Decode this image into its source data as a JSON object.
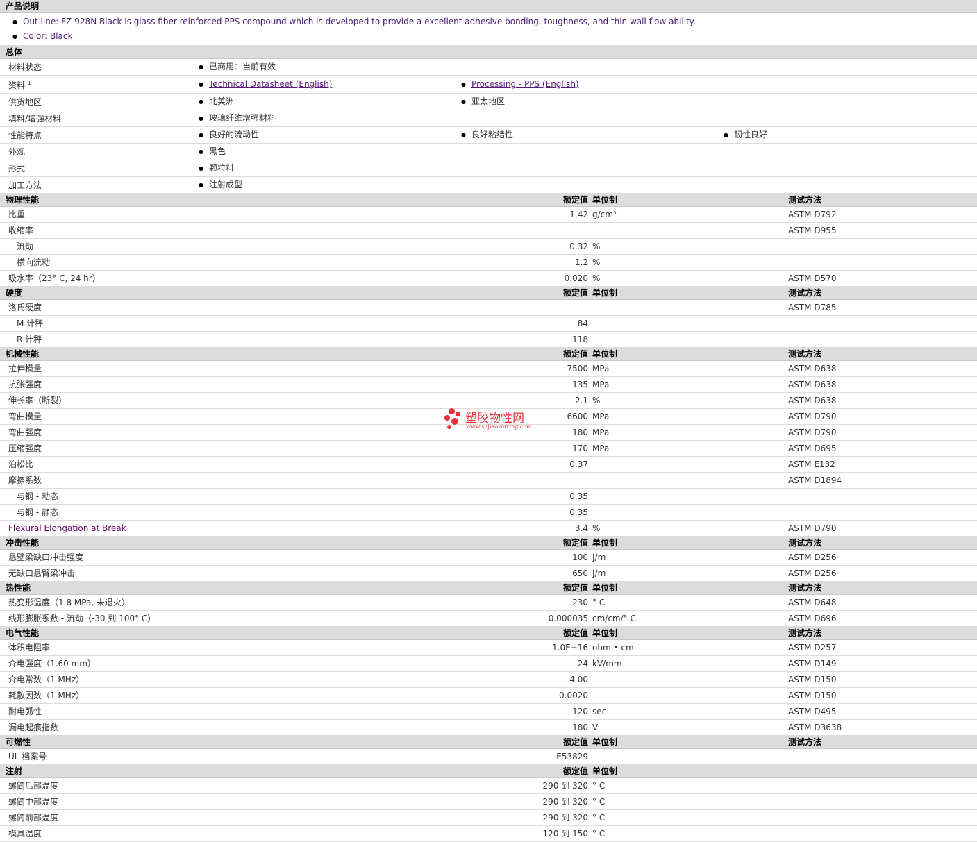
{
  "intro": {
    "heading": "产品说明",
    "lines": [
      "Out line: FZ-928N Black is glass fiber reinforced PPS compound which is developed to provide a excellent adhesive bonding, toughness, and thin wall flow ability.",
      "Color: Black"
    ]
  },
  "general": {
    "heading": "总体",
    "rows": [
      {
        "label": "材料状态",
        "items": [
          "已商用：当前有效"
        ]
      },
      {
        "label": "资料",
        "sup": "1",
        "items": [
          "Technical Datasheet (English)",
          "Processing - PPS (English)"
        ],
        "links": true
      },
      {
        "label": "供货地区",
        "items": [
          "北美洲",
          "亚太地区"
        ]
      },
      {
        "label": "填料/增强材料",
        "items": [
          "玻璃纤维增强材料"
        ]
      },
      {
        "label": "性能特点",
        "items": [
          "良好的流动性",
          "良好粘结性",
          "韧性良好"
        ]
      },
      {
        "label": "外观",
        "items": [
          "黑色"
        ]
      },
      {
        "label": "形式",
        "items": [
          "颗粒料"
        ]
      },
      {
        "label": "加工方法",
        "items": [
          "注射成型"
        ]
      }
    ]
  },
  "columns": {
    "nominal": "额定值",
    "unit": "单位制",
    "method": "测试方法"
  },
  "sections": [
    {
      "heading": "物理性能",
      "show_method": true,
      "rows": [
        {
          "label": "比重",
          "value": "1.42",
          "unit": "g/cm³",
          "method": "ASTM D792"
        },
        {
          "label": "收缩率",
          "value": "",
          "unit": "",
          "method": "ASTM D955"
        },
        {
          "label": "流动",
          "sub": true,
          "value": "0.32",
          "unit": "%",
          "method": ""
        },
        {
          "label": "横向流动",
          "sub": true,
          "value": "1.2",
          "unit": "%",
          "method": ""
        },
        {
          "label": "吸水率（23° C, 24 hr）",
          "value": "0.020",
          "unit": "%",
          "method": "ASTM D570"
        }
      ]
    },
    {
      "heading": "硬度",
      "show_method": true,
      "rows": [
        {
          "label": "洛氏硬度",
          "value": "",
          "unit": "",
          "method": "ASTM D785"
        },
        {
          "label": "M 计秤",
          "sub": true,
          "value": "84",
          "unit": "",
          "method": ""
        },
        {
          "label": "R 计秤",
          "sub": true,
          "value": "118",
          "unit": "",
          "method": ""
        }
      ]
    },
    {
      "heading": "机械性能",
      "show_method": true,
      "rows": [
        {
          "label": "拉伸模量",
          "value": "7500",
          "unit": "MPa",
          "method": "ASTM D638"
        },
        {
          "label": "抗张强度",
          "value": "135",
          "unit": "MPa",
          "method": "ASTM D638"
        },
        {
          "label": "伸长率（断裂）",
          "value": "2.1",
          "unit": "%",
          "method": "ASTM D638"
        },
        {
          "label": "弯曲模量",
          "value": "6600",
          "unit": "MPa",
          "method": "ASTM D790"
        },
        {
          "label": "弯曲强度",
          "value": "180",
          "unit": "MPa",
          "method": "ASTM D790"
        },
        {
          "label": "压缩强度",
          "value": "170",
          "unit": "MPa",
          "method": "ASTM D695"
        },
        {
          "label": "泊松比",
          "value": "0.37",
          "unit": "",
          "method": "ASTM E132"
        },
        {
          "label": "摩擦系数",
          "value": "",
          "unit": "",
          "method": "ASTM D1894"
        },
        {
          "label": "与钢 - 动态",
          "sub": true,
          "value": "0.35",
          "unit": "",
          "method": ""
        },
        {
          "label": "与钢 - 静态",
          "sub": true,
          "value": "0.35",
          "unit": "",
          "method": ""
        },
        {
          "label": "Flexural Elongation at Break",
          "purple": true,
          "value": "3.4",
          "unit": "%",
          "method": "ASTM D790"
        }
      ]
    },
    {
      "heading": "冲击性能",
      "show_method": true,
      "rows": [
        {
          "label": "悬壁梁缺口冲击强度",
          "value": "100",
          "unit": "J/m",
          "method": "ASTM D256"
        },
        {
          "label": "无缺口悬臂梁冲击",
          "value": "650",
          "unit": "J/m",
          "method": "ASTM D256"
        }
      ]
    },
    {
      "heading": "热性能",
      "show_method": true,
      "rows": [
        {
          "label": "热变形温度（1.8 MPa, 未退火）",
          "value": "230",
          "unit": "° C",
          "method": "ASTM D648"
        },
        {
          "label": "线形膨胀系数 - 流动（-30 到 100° C）",
          "value": "0.000035",
          "unit": "cm/cm/° C",
          "method": "ASTM D696"
        }
      ]
    },
    {
      "heading": "电气性能",
      "show_method": true,
      "rows": [
        {
          "label": "体积电阻率",
          "value": "1.0E+16",
          "unit": "ohm • cm",
          "method": "ASTM D257"
        },
        {
          "label": "介电强度（1.60 mm）",
          "value": "24",
          "unit": "kV/mm",
          "method": "ASTM D149"
        },
        {
          "label": "介电常数（1 MHz）",
          "value": "4.00",
          "unit": "",
          "method": "ASTM D150"
        },
        {
          "label": "耗散因数（1 MHz）",
          "value": "0.0020",
          "unit": "",
          "method": "ASTM D150"
        },
        {
          "label": "耐电弧性",
          "value": "120",
          "unit": "sec",
          "method": "ASTM D495"
        },
        {
          "label": "漏电起痕指数",
          "value": "180",
          "unit": "V",
          "method": "ASTM D3638"
        }
      ]
    },
    {
      "heading": "可燃性",
      "show_method": true,
      "rows": [
        {
          "label": "UL 档案号",
          "value": "E53829",
          "unit": "",
          "method": ""
        }
      ]
    },
    {
      "heading": "注射",
      "show_method": false,
      "rows": [
        {
          "label": "螺筒后部温度",
          "value": "290 到  320",
          "unit": "° C",
          "method": ""
        },
        {
          "label": "螺筒中部温度",
          "value": "290 到  320",
          "unit": "° C",
          "method": ""
        },
        {
          "label": "螺筒前部温度",
          "value": "290 到  320",
          "unit": "° C",
          "method": ""
        },
        {
          "label": "模具温度",
          "value": "120 到  150",
          "unit": "° C",
          "method": ""
        }
      ]
    }
  ],
  "watermark": {
    "text": "塑胶物性网",
    "url": "www.sujiaowuxing.com"
  }
}
